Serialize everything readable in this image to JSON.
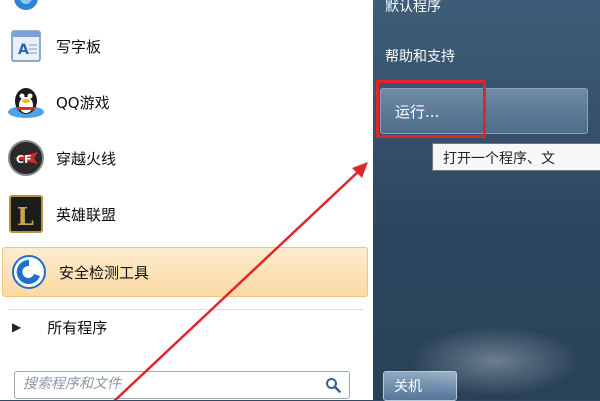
{
  "programs": [
    {
      "label": "写字板",
      "icon": "wordpad-icon"
    },
    {
      "label": "QQ游戏",
      "icon": "qq-game-icon"
    },
    {
      "label": "穿越火线",
      "icon": "crossfire-icon"
    },
    {
      "label": "英雄联盟",
      "icon": "league-of-legends-icon"
    },
    {
      "label": "安全检测工具",
      "icon": "security-check-icon",
      "highlighted": true
    }
  ],
  "all_programs": {
    "label": "所有程序",
    "icon": "triangle-right-icon"
  },
  "search": {
    "placeholder": "搜索程序和文件",
    "icon": "search-icon"
  },
  "right_panel": {
    "default_programs": "默认程序",
    "help_support": "帮助和支持",
    "run": "运行...",
    "run_tooltip": "打开一个程序、文",
    "shutdown": "关机"
  },
  "annotations": {
    "highlight_color": "#e0262b",
    "arrow_color": "#e0262b"
  }
}
